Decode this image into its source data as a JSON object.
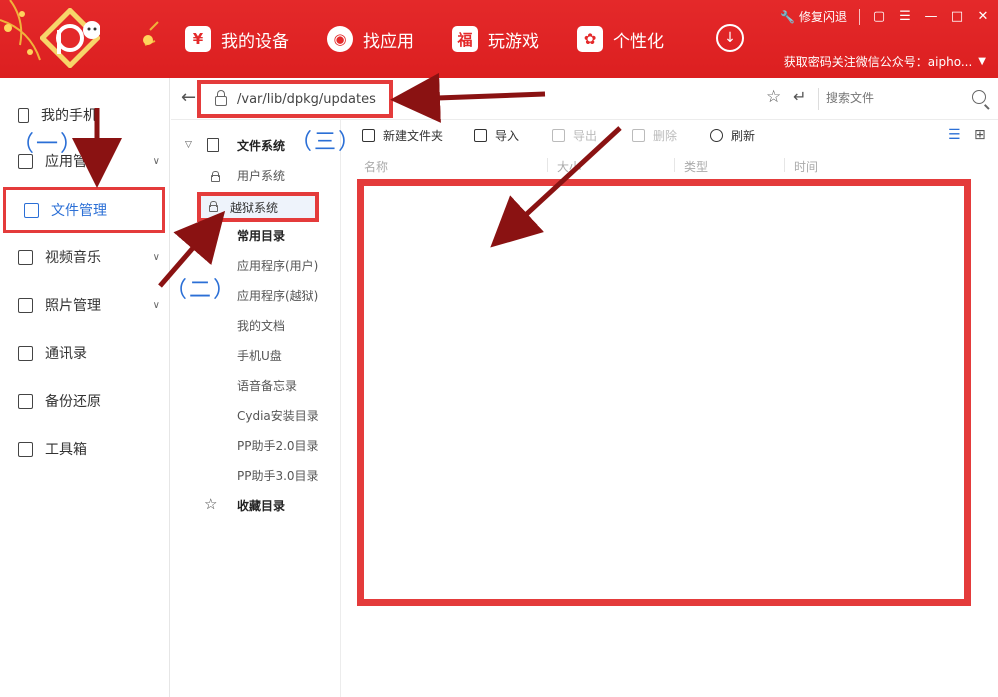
{
  "header": {
    "nav": [
      {
        "label": "我的设备",
        "icon": "device-icon"
      },
      {
        "label": "找应用",
        "icon": "apps-icon"
      },
      {
        "label": "玩游戏",
        "icon": "game-icon"
      },
      {
        "label": "个性化",
        "icon": "theme-icon"
      }
    ],
    "repair_label": "修复闪退",
    "wechat_tip": "获取密码关注微信公众号：aipho...",
    "colors": {
      "brand": "#e4292a",
      "accent": "#2b6fd6",
      "highlight": "#e43b3b"
    }
  },
  "sidebar": {
    "items": [
      {
        "label": "我的手机"
      },
      {
        "label": "应用管理"
      },
      {
        "label": "文件管理"
      },
      {
        "label": "视频音乐"
      },
      {
        "label": "照片管理"
      },
      {
        "label": "通讯录"
      },
      {
        "label": "备份还原"
      },
      {
        "label": "工具箱"
      }
    ],
    "active": "文件管理"
  },
  "addressbar": {
    "path": "/var/lib/dpkg/updates",
    "search_placeholder": "搜索文件"
  },
  "tree": {
    "filesystem": "文件系统",
    "user_system": "用户系统",
    "jailbreak_system": "越狱系统",
    "common_dirs": "常用目录",
    "dirs": [
      "应用程序(用户)",
      "应用程序(越狱)",
      "我的文档",
      "手机U盘",
      "语音备忘录",
      "Cydia安装目录",
      "PP助手2.0目录",
      "PP助手3.0目录"
    ],
    "favorites": "收藏目录"
  },
  "actions": {
    "new_folder": "新建文件夹",
    "import": "导入",
    "export": "导出",
    "delete": "删除",
    "refresh": "刷新"
  },
  "columns": [
    "名称",
    "大小",
    "类型",
    "时间"
  ],
  "annotations": {
    "one": "（一）",
    "two": "（二）",
    "three": "（三）"
  }
}
